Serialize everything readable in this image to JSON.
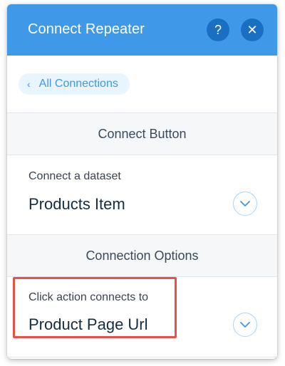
{
  "header": {
    "title": "Connect Repeater",
    "help_label": "?",
    "close_label": "✕"
  },
  "back": {
    "label": "All Connections",
    "chevron": "‹"
  },
  "connect_button": {
    "title": "Connect Button",
    "dataset_label": "Connect a dataset",
    "dataset_value": "Products Item"
  },
  "connection_options": {
    "title": "Connection Options",
    "click_action_label": "Click action connects to",
    "click_action_value": "Product Page Url"
  },
  "colors": {
    "header_bg": "#3f98e8",
    "header_button_bg": "#1a6fc2",
    "highlight": "#e8514a",
    "accent": "#3f98e8"
  },
  "icons": {
    "help": "help-icon",
    "close": "close-icon",
    "back": "chevron-left-icon",
    "dropdown": "chevron-down-icon"
  }
}
